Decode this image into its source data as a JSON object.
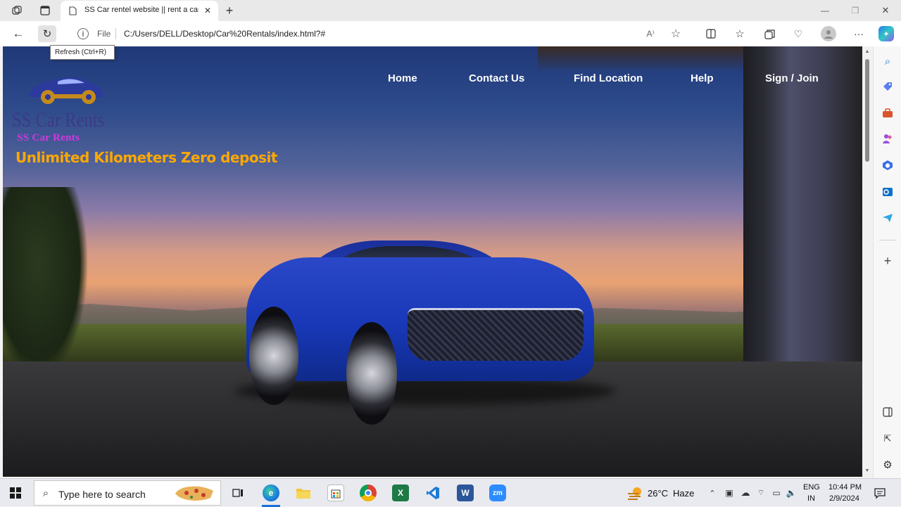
{
  "browser": {
    "tab_title": "SS Car rentel website || rent a car",
    "new_tab_symbol": "+",
    "file_label": "File",
    "url": "C:/Users/DELL/Desktop/Car%20Rentals/index.html?#",
    "tooltip": "Refresh (Ctrl+R)",
    "window_controls": [
      "minimize-icon",
      "restore-icon",
      "close-icon"
    ],
    "toolbar_icons": [
      "read-aloud-icon",
      "favorite-star-icon",
      "split-screen-icon",
      "favorites-icon",
      "collections-icon",
      "browser-essentials-icon",
      "profile-avatar-icon",
      "more-options-icon",
      "copilot-icon"
    ]
  },
  "site": {
    "nav": [
      {
        "label": "Home"
      },
      {
        "label": "Contact Us"
      },
      {
        "label": "Find Location"
      },
      {
        "label": "Help"
      },
      {
        "label": "Sign / Join"
      }
    ],
    "logo_text": "SS Car Rents",
    "logo_subtext": "SS Car Rents",
    "tagline": "Unlimited Kilometers Zero deposit",
    "colors": {
      "logo": "#3b3a86",
      "logo_sub": "#d436e0",
      "tagline": "#ffa800",
      "nav_text": "#ffffff"
    }
  },
  "sidebar": {
    "icons": [
      "search-icon",
      "tag-icon",
      "briefcase-icon",
      "people-icon",
      "office-icon",
      "outlook-icon",
      "send-icon",
      "add-icon",
      "sidebar-layout-icon",
      "external-link-icon",
      "settings-icon"
    ]
  },
  "taskbar": {
    "search_placeholder": "Type here to search",
    "weather_temp": "26°C",
    "weather_desc": "Haze",
    "lang_line1": "ENG",
    "lang_line2": "IN",
    "time": "10:44 PM",
    "date": "2/9/2024",
    "apps": [
      {
        "name": "task-view",
        "label": ""
      },
      {
        "name": "edge",
        "label": "e"
      },
      {
        "name": "file-explorer",
        "label": ""
      },
      {
        "name": "store",
        "label": ""
      },
      {
        "name": "chrome",
        "label": ""
      },
      {
        "name": "excel",
        "label": "X"
      },
      {
        "name": "vscode",
        "label": ""
      },
      {
        "name": "word",
        "label": "W"
      },
      {
        "name": "zoom",
        "label": "zm"
      }
    ]
  }
}
